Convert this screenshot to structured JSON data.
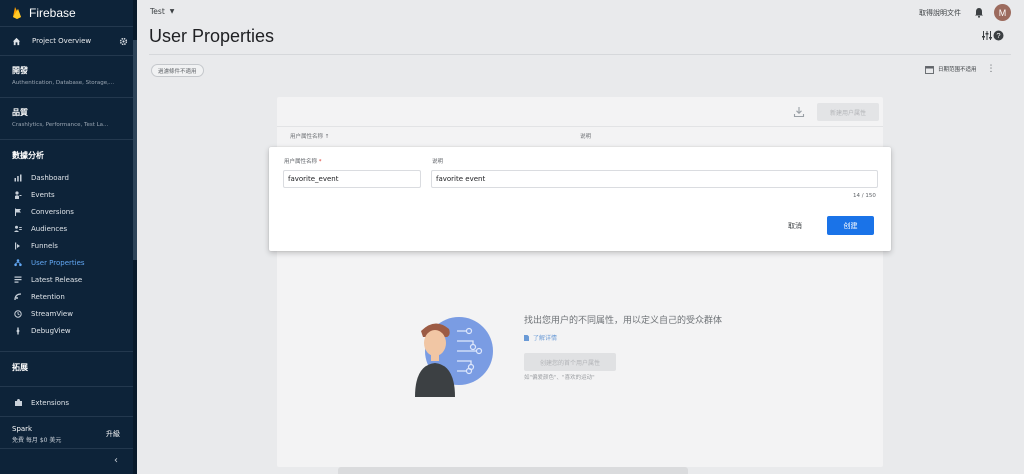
{
  "sidebar": {
    "brand": "Firebase",
    "overview": "Project Overview",
    "sections": [
      {
        "title": "開發",
        "subtitle": "Authentication, Database, Storage,..."
      },
      {
        "title": "品質",
        "subtitle": "Crashlytics, Performance, Test La..."
      }
    ],
    "analytics_header": "數據分析",
    "items": [
      {
        "label": "Dashboard",
        "icon": "dashboard-icon"
      },
      {
        "label": "Events",
        "icon": "events-icon"
      },
      {
        "label": "Conversions",
        "icon": "flag-icon"
      },
      {
        "label": "Audiences",
        "icon": "audiences-icon"
      },
      {
        "label": "Funnels",
        "icon": "funnel-icon"
      },
      {
        "label": "User Properties",
        "icon": "user-properties-icon",
        "active": true
      },
      {
        "label": "Latest Release",
        "icon": "release-icon"
      },
      {
        "label": "Retention",
        "icon": "retention-icon"
      },
      {
        "label": "StreamView",
        "icon": "streamview-icon"
      },
      {
        "label": "DebugView",
        "icon": "debug-icon"
      }
    ],
    "extend_header": "拓展",
    "extensions": "Extensions",
    "plan_name": "Spark",
    "plan_detail": "免費 每月 $0 美元",
    "upgrade": "升級",
    "collapse": "‹"
  },
  "topbar": {
    "project": "Test",
    "help": "取得說明文件",
    "avatar_letter": "M"
  },
  "page": {
    "title": "User Properties",
    "filter_chip": "過濾條件不適用",
    "date_range": "日期范围不适用"
  },
  "card": {
    "new_button": "新建用户属性",
    "col_name": "用户属性名称 ↑",
    "col_desc": "说明",
    "empty_title": "找出您用户的不同属性，用以定义自己的受众群体",
    "empty_link": "了解详情",
    "empty_button": "创建您的首个用户属性",
    "empty_hint": "如\"偏爱颜色\"、\"喜欢的运动\""
  },
  "dialog": {
    "name_label": "用户属性名称",
    "required_mark": "*",
    "name_value": "favorite_event",
    "desc_label": "说明",
    "desc_value": "favorite event",
    "counter": "14 / 150",
    "cancel": "取消",
    "create": "创建"
  },
  "colors": {
    "sidebar_bg": "#0d2339",
    "accent": "#1a73e8",
    "active_item": "#62a8f5"
  }
}
